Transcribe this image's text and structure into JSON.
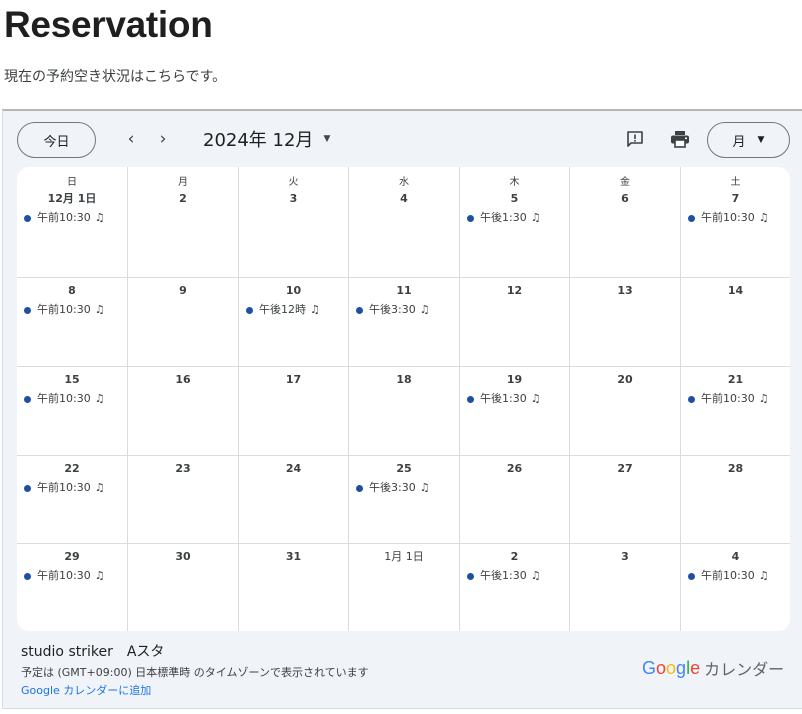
{
  "page": {
    "title": "Reservation",
    "subtitle": "現在の予約空き状況はこちらです。"
  },
  "toolbar": {
    "today_label": "今日",
    "prev_icon": "chevron-left-icon",
    "next_icon": "chevron-right-icon",
    "month_label": "2024年 12月",
    "feedback_icon": "feedback-icon",
    "print_icon": "print-icon",
    "view_label": "月"
  },
  "weekdays": [
    "日",
    "月",
    "火",
    "水",
    "木",
    "金",
    "土"
  ],
  "weeks": [
    [
      {
        "label": "12月 1日",
        "events": [
          "午前10:30"
        ]
      },
      {
        "label": "2",
        "events": []
      },
      {
        "label": "3",
        "events": []
      },
      {
        "label": "4",
        "events": []
      },
      {
        "label": "5",
        "events": [
          "午後1:30"
        ]
      },
      {
        "label": "6",
        "events": []
      },
      {
        "label": "7",
        "events": [
          "午前10:30"
        ]
      }
    ],
    [
      {
        "label": "8",
        "events": [
          "午前10:30"
        ]
      },
      {
        "label": "9",
        "events": []
      },
      {
        "label": "10",
        "events": [
          "午後12時"
        ]
      },
      {
        "label": "11",
        "events": [
          "午後3:30"
        ]
      },
      {
        "label": "12",
        "events": []
      },
      {
        "label": "13",
        "events": []
      },
      {
        "label": "14",
        "events": []
      }
    ],
    [
      {
        "label": "15",
        "events": [
          "午前10:30"
        ]
      },
      {
        "label": "16",
        "events": []
      },
      {
        "label": "17",
        "events": []
      },
      {
        "label": "18",
        "events": []
      },
      {
        "label": "19",
        "events": [
          "午後1:30"
        ]
      },
      {
        "label": "20",
        "events": []
      },
      {
        "label": "21",
        "events": [
          "午前10:30"
        ]
      }
    ],
    [
      {
        "label": "22",
        "events": [
          "午前10:30"
        ]
      },
      {
        "label": "23",
        "events": []
      },
      {
        "label": "24",
        "events": []
      },
      {
        "label": "25",
        "events": [
          "午後3:30"
        ]
      },
      {
        "label": "26",
        "events": []
      },
      {
        "label": "27",
        "events": []
      },
      {
        "label": "28",
        "events": []
      }
    ],
    [
      {
        "label": "29",
        "events": [
          "午前10:30"
        ]
      },
      {
        "label": "30",
        "events": []
      },
      {
        "label": "31",
        "events": []
      },
      {
        "label": "1月 1日",
        "events": []
      },
      {
        "label": "2",
        "events": [
          "午後1:30"
        ]
      },
      {
        "label": "3",
        "events": []
      },
      {
        "label": "4",
        "events": [
          "午前10:30"
        ]
      }
    ]
  ],
  "event_icon": "music-note-icon",
  "event_color": "#1e4fa2",
  "footer": {
    "calendar_name": "studio striker　Aスタ",
    "timezone_note": "予定は (GMT+09:00) 日本標準時 のタイムゾーンで表示されています",
    "add_link": "Google カレンダーに追加",
    "brand_logo": "Google",
    "brand_suffix": "カレンダー"
  },
  "colors": {
    "background": "#f0f4f9",
    "link": "#1a73e8"
  }
}
